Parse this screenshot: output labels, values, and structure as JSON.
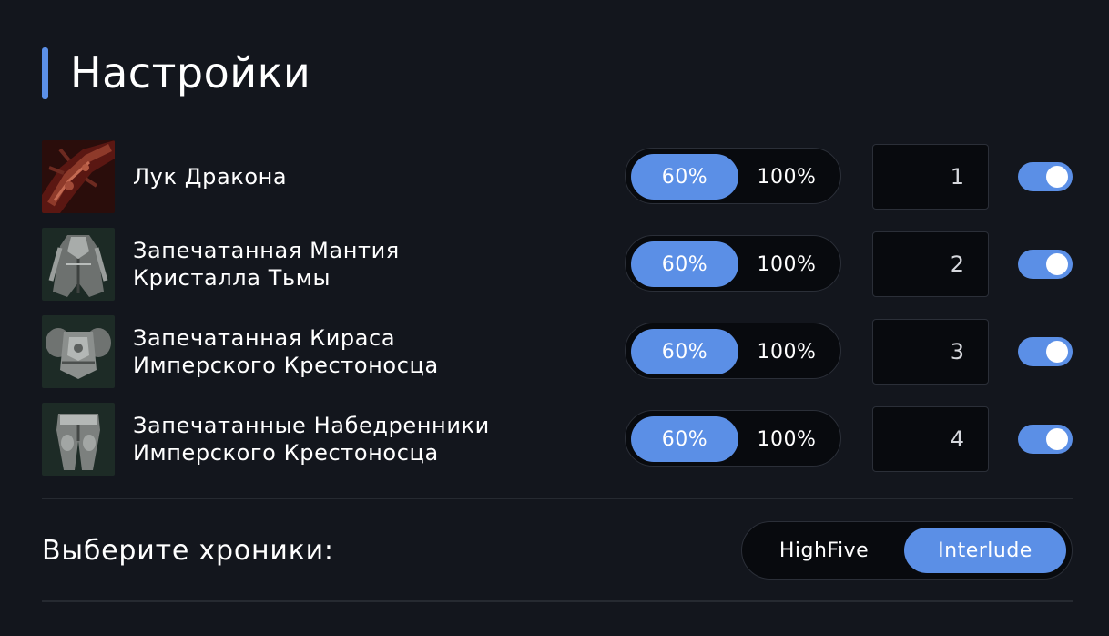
{
  "page": {
    "title": "Настройки"
  },
  "items": [
    {
      "name": "Лук Дракона",
      "thumb_icon": "dragon-bow-icon",
      "option_a": "60%",
      "option_b": "100%",
      "selected": "60%",
      "quantity": "1",
      "enabled": true
    },
    {
      "name": "Запечатанная Мантия\nКристалла Тьмы",
      "thumb_icon": "robe-icon",
      "option_a": "60%",
      "option_b": "100%",
      "selected": "60%",
      "quantity": "2",
      "enabled": true
    },
    {
      "name": "Запечатанная Кираса\nИмперского Крестоносца",
      "thumb_icon": "cuirass-icon",
      "option_a": "60%",
      "option_b": "100%",
      "selected": "60%",
      "quantity": "3",
      "enabled": true
    },
    {
      "name": "Запечатанные Набедренники\nИмперского Крестоносца",
      "thumb_icon": "gaiters-icon",
      "option_a": "60%",
      "option_b": "100%",
      "selected": "60%",
      "quantity": "4",
      "enabled": true
    }
  ],
  "chronicles": {
    "label": "Выберите хроники:",
    "options": [
      "HighFive",
      "Interlude"
    ],
    "selected": "Interlude"
  },
  "colors": {
    "accent": "#5b8fe6",
    "background": "#13161d",
    "field": "#080a0e"
  }
}
